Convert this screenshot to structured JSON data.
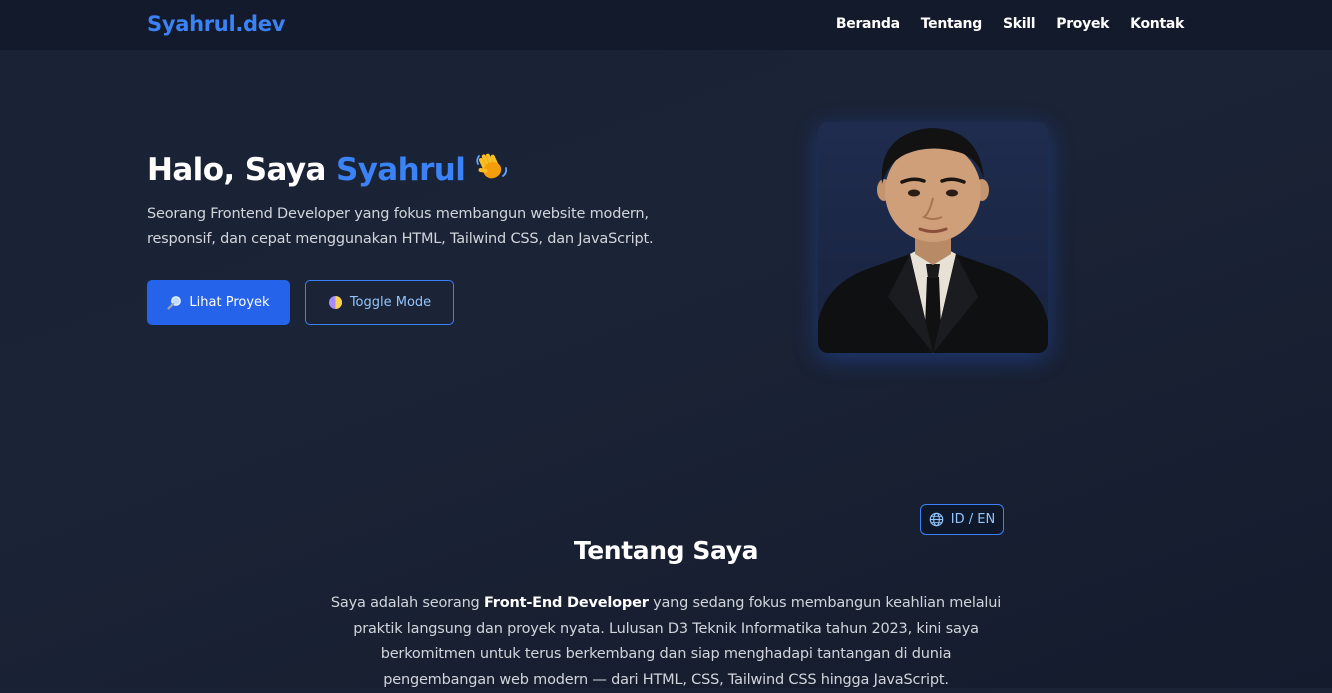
{
  "nav": {
    "brand": "Syahrul.dev",
    "links": [
      "Beranda",
      "Tentang",
      "Skill",
      "Proyek",
      "Kontak"
    ]
  },
  "hero": {
    "title_prefix": "Halo, Saya ",
    "title_name": "Syahrul",
    "wave_icon": "waving-hand-icon",
    "description": "Seorang Frontend Developer yang fokus membangun website modern, responsif, dan cepat menggunakan HTML, Tailwind CSS, dan JavaScript.",
    "primary_button": "Lihat Proyek",
    "primary_icon": "magnifier-icon",
    "secondary_button": "Toggle Mode",
    "secondary_icon": "half-moon-icon"
  },
  "about": {
    "lang_toggle": "ID / EN",
    "lang_icon": "globe-icon",
    "title": "Tentang Saya",
    "text_before": "Saya adalah seorang ",
    "text_bold": "Front-End Developer",
    "text_after": " yang sedang fokus membangun keahlian melalui praktik langsung dan proyek nyata. Lulusan D3 Teknik Informatika tahun 2023, kini saya berkomitmen untuk terus berkembang dan siap menghadapi tantangan di dunia pengembangan web modern — dari HTML, CSS, Tailwind CSS hingga JavaScript."
  },
  "colors": {
    "accent": "#3b82f6",
    "primary_button": "#2563eb",
    "nav_bg": "#131a2b",
    "page_bg": "#1a2236"
  }
}
